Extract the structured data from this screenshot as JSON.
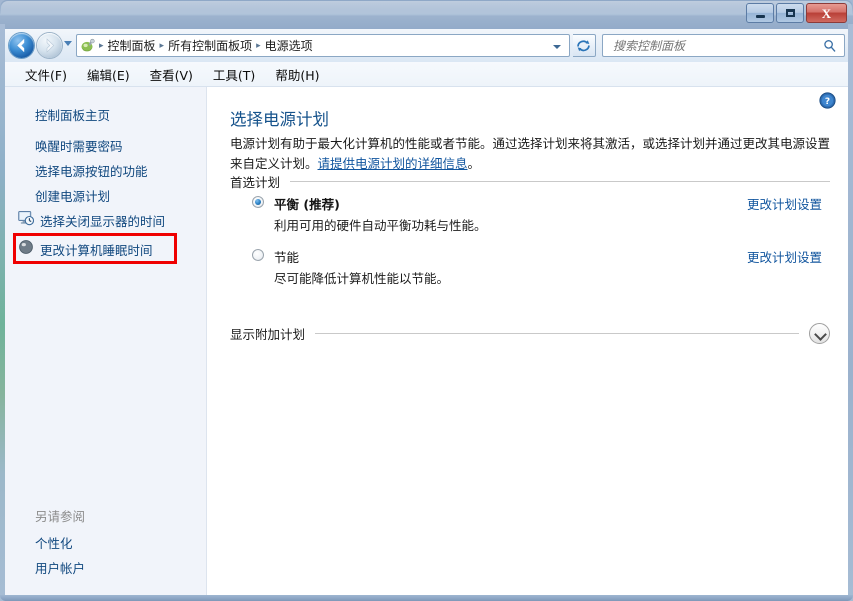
{
  "window": {
    "controls": {
      "minimize": "–",
      "maximize": "□",
      "close": "X"
    }
  },
  "toolbar": {
    "back_icon": "back-arrow-icon",
    "forward_icon": "forward-arrow-icon",
    "history_dropdown_icon": "chevron-down-icon",
    "address_icon": "control-panel-icon",
    "breadcrumbs": [
      "控制面板",
      "所有控制面板项",
      "电源选项"
    ],
    "separator": "▸",
    "address_caret_icon": "chevron-down-icon",
    "refresh_icon": "refresh-icon",
    "search": {
      "placeholder": "搜索控制面板",
      "value": "",
      "icon": "search-icon"
    }
  },
  "menubar": {
    "items": [
      "文件(F)",
      "编辑(E)",
      "查看(V)",
      "工具(T)",
      "帮助(H)"
    ]
  },
  "sidebar": {
    "home_label": "控制面板主页",
    "items": [
      {
        "label": "唤醒时需要密码",
        "icon": null
      },
      {
        "label": "选择电源按钮的功能",
        "icon": null
      },
      {
        "label": "创建电源计划",
        "icon": null
      },
      {
        "label": "选择关闭显示器的时间",
        "icon": "monitor-clock-icon"
      },
      {
        "label": "更改计算机睡眠时间",
        "icon": "sleep-icon"
      }
    ],
    "highlight": {
      "target_label": "更改计算机睡眠时间",
      "color": "#ef0000"
    },
    "see_also": {
      "label": "另请参阅",
      "links": [
        "个性化",
        "用户帐户"
      ]
    }
  },
  "content": {
    "help_icon": "help-icon",
    "title": "选择电源计划",
    "description_part1": "电源计划有助于最大化计算机的性能或者节能。通过选择计划来将其激活，或选择计划并通过更改其电源设置来自定义计划。",
    "description_link": "请提供电源计划的详细信息",
    "description_part2": "。",
    "group_label": "首选计划",
    "plans": [
      {
        "name": "平衡 (推荐)",
        "description": "利用可用的硬件自动平衡功耗与性能。",
        "selected": true,
        "link_label": "更改计划设置"
      },
      {
        "name": "节能",
        "description": "尽可能降低计算机性能以节能。",
        "selected": false,
        "link_label": "更改计划设置"
      }
    ],
    "show_additional_label": "显示附加计划",
    "show_additional_icon": "chevron-down-icon"
  }
}
